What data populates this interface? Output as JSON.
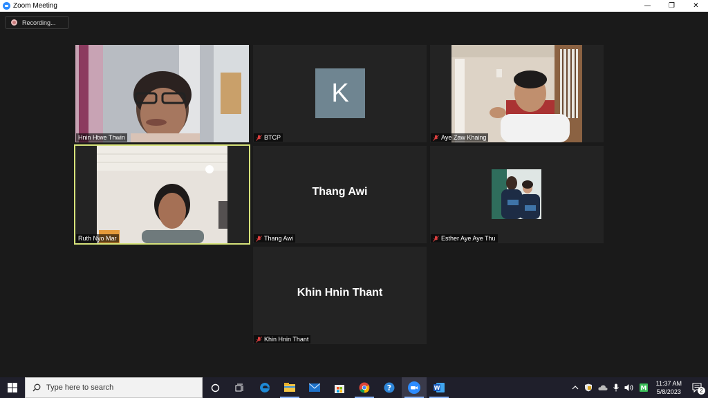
{
  "window": {
    "title": "Zoom Meeting",
    "controls": [
      "—",
      "❐",
      "✕"
    ]
  },
  "recording": {
    "label": "Recording..."
  },
  "participants": [
    {
      "name": "Hnin Htwe Thwin",
      "muted": false,
      "type": "video"
    },
    {
      "name": "BTCP",
      "muted": true,
      "type": "avatar",
      "avatar_letter": "K",
      "avatar_color": "#6f8591"
    },
    {
      "name": "Aye Zaw Khaing",
      "muted": true,
      "type": "video"
    },
    {
      "name": "Ruth Nyo Mar",
      "muted": false,
      "type": "video",
      "active_speaker": true
    },
    {
      "name": "Thang Awi",
      "muted": true,
      "type": "name",
      "display_name": "Thang Awi"
    },
    {
      "name": "Esther Aye Aye Thu",
      "muted": true,
      "type": "photo"
    },
    {
      "name": "Khin Hnin Thant",
      "muted": true,
      "type": "name",
      "display_name": "Khin Hnin Thant"
    }
  ],
  "taskbar": {
    "search_placeholder": "Type here to search",
    "apps": [
      "task-view",
      "edge",
      "file-explorer",
      "mail",
      "store",
      "chrome",
      "help",
      "zoom",
      "word"
    ],
    "clock": {
      "time": "11:37 AM",
      "date": "5/8/2023"
    },
    "notification_count": "2"
  },
  "colors": {
    "active_speaker_border": "#d7e37a",
    "zoom_blue": "#2d8cff",
    "muted_red": "#e04040"
  }
}
